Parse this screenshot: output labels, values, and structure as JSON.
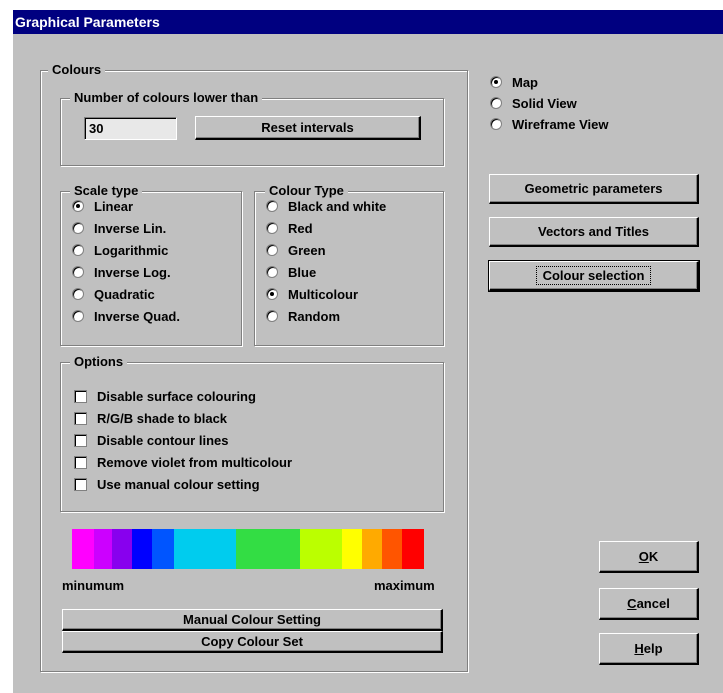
{
  "window": {
    "title": "Graphical Parameters"
  },
  "colours_group": {
    "label": "Colours",
    "number_group": {
      "label": "Number of colours lower than",
      "value": "30",
      "reset_button": "Reset intervals"
    },
    "scale_type": {
      "label": "Scale type",
      "options": [
        "Linear",
        "Inverse Lin.",
        "Logarithmic",
        "Inverse Log.",
        "Quadratic",
        "Inverse Quad."
      ],
      "selected": "Linear"
    },
    "colour_type": {
      "label": "Colour Type",
      "options": [
        "Black and white",
        "Red",
        "Green",
        "Blue",
        "Multicolour",
        "Random"
      ],
      "selected": "Multicolour"
    },
    "options_group": {
      "label": "Options",
      "checkboxes": [
        {
          "label": "Disable surface colouring",
          "checked": false
        },
        {
          "label": "R/G/B shade to black",
          "checked": false
        },
        {
          "label": "Disable contour lines",
          "checked": false
        },
        {
          "label": "Remove violet from multicolour",
          "checked": false
        },
        {
          "label": "Use manual colour setting",
          "checked": false
        }
      ]
    },
    "colour_bar": {
      "swatches": [
        "#ff00ff",
        "#cc00ff",
        "#8800ee",
        "#0000ff",
        "#0055ff",
        "#00ccee",
        "#33dd44",
        "#bbff00",
        "#ffff00",
        "#ffaa00",
        "#ff5500",
        "#ff0000"
      ],
      "min_label": "minumum",
      "max_label": "maximum"
    },
    "manual_button": "Manual Colour Setting",
    "copy_button": "Copy Colour Set"
  },
  "view_mode": {
    "options": [
      "Map",
      "Solid View",
      "Wireframe View"
    ],
    "selected": "Map"
  },
  "right_buttons": {
    "geometric": "Geometric parameters",
    "vectors": "Vectors and Titles",
    "colour_selection": "Colour selection"
  },
  "dialog_buttons": {
    "ok_accel": "O",
    "ok_rest": "K",
    "cancel_accel": "C",
    "cancel_rest": "ancel",
    "help_accel": "H",
    "help_rest": "elp"
  },
  "colors": {
    "title_bar": "#000080",
    "face": "#c0c0c0"
  }
}
